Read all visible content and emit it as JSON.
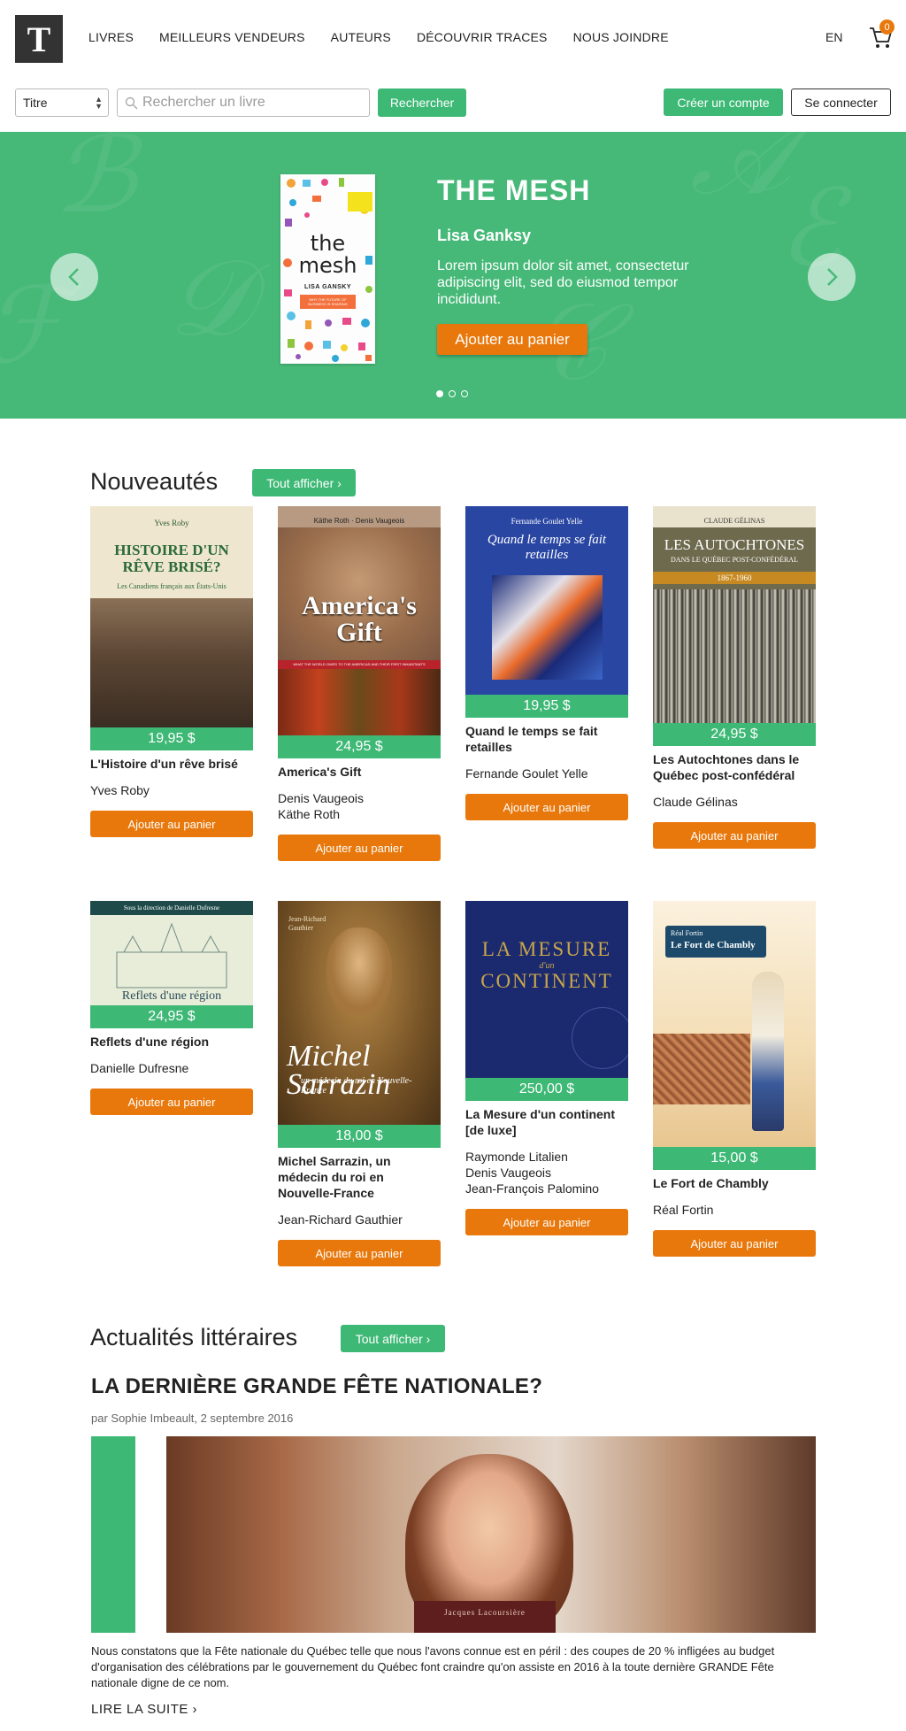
{
  "header": {
    "logo_letter": "T",
    "nav": [
      "LIVRES",
      "MEILLEURS VENDEURS",
      "AUTEURS",
      "DÉCOUVRIR TRACES",
      "NOUS JOINDRE"
    ],
    "lang": "EN",
    "cart_count": "0"
  },
  "search": {
    "select_value": "Titre",
    "placeholder": "Rechercher un livre",
    "button": "Rechercher",
    "create_account": "Créer un compte",
    "login": "Se connecter"
  },
  "hero": {
    "title": "THE MESH",
    "author": "Lisa Ganksy",
    "text": "Lorem ipsum dolor sit amet, consectetur adipiscing elit, sed do eiusmod tempor incididunt.",
    "button": "Ajouter au panier",
    "cover": {
      "title_line1": "the",
      "title_line2": "mesh",
      "author": "LISA GANSKY",
      "subtitle": "WHY THE FUTURE OF BUSINESS IS SHARING"
    },
    "slides": 3,
    "active_slide": 1
  },
  "nouveautes": {
    "title": "Nouveautés",
    "show_all": "Tout afficher ›",
    "books": [
      {
        "cover_top": "Yves Roby",
        "cover_title": "HISTOIRE D'UN RÊVE BRISÉ?",
        "cover_sub": "Les Canadiens français aux États-Unis",
        "price": "19,95 $",
        "title": "L'Histoire d'un rêve brisé",
        "authors": [
          "Yves Roby"
        ],
        "button": "Ajouter au panier"
      },
      {
        "cover_top": "Käthe Roth · Denis Vaugeois",
        "cover_title": "America's Gift",
        "cover_sub": "WHAT THE WORLD OWES TO THE AMERICAS AND THEIR FIRST INHABITANTS",
        "price": "24,95 $",
        "title": "America's Gift",
        "authors": [
          "Denis Vaugeois",
          "Käthe Roth"
        ],
        "button": "Ajouter au panier"
      },
      {
        "cover_top": "Fernande Goulet Yelle",
        "cover_title": "Quand le temps se fait retailles",
        "price": "19,95 $",
        "title": "Quand le temps se fait retailles",
        "authors": [
          "Fernande Goulet Yelle"
        ],
        "button": "Ajouter au panier"
      },
      {
        "cover_top": "CLAUDE GÉLINAS",
        "cover_title": "LES AUTOCHTONES",
        "cover_sub": "DANS LE QUÉBEC POST-CONFÉDÉRAL",
        "cover_years": "1867-1960",
        "price": "24,95 $",
        "title": "Les Autochtones dans le Québec post-confédéral",
        "authors": [
          "Claude Gélinas"
        ],
        "button": "Ajouter au panier"
      },
      {
        "cover_top": "Sous la direction de Danielle Dufresne",
        "cover_title": "Reflets d'une région",
        "price": "24,95 $",
        "title": "Reflets d'une région",
        "authors": [
          "Danielle Dufresne"
        ],
        "button": "Ajouter au panier"
      },
      {
        "cover_top": "Jean-Richard Gauthier",
        "cover_title": "Michel Sarrazin",
        "cover_sub": "un médecin du roi en Nouvelle-France",
        "price": "18,00 $",
        "title": "Michel Sarrazin, un médecin du roi en Nouvelle-France",
        "authors": [
          "Jean-Richard Gauthier"
        ],
        "button": "Ajouter au panier"
      },
      {
        "cover_title": "LA MESURE",
        "cover_sub": "d'un",
        "cover_title2": "CONTINENT",
        "price": "250,00 $",
        "title": "La Mesure d'un continent [de luxe]",
        "authors": [
          "Raymonde Litalien",
          "Denis Vaugeois",
          "Jean-François Palomino"
        ],
        "button": "Ajouter au panier"
      },
      {
        "cover_top": "Réal Fortin",
        "cover_title": "Le Fort de Chambly",
        "price": "15,00 $",
        "title": "Le Fort de Chambly",
        "authors": [
          "Réal Fortin"
        ],
        "button": "Ajouter au panier"
      }
    ]
  },
  "actualites": {
    "title": "Actualités littéraires",
    "show_all": "Tout afficher ›",
    "article_title": "LA DERNIÈRE GRANDE FÊTE NATIONALE?",
    "meta": "par Sophie Imbeault, 2 septembre 2016",
    "image_caption": "Jacques Lacoursière",
    "text": "Nous constatons que la Fête nationale du Québec telle que nous l'avons connue est en péril : des coupes de 20 % infligées au budget d'organisation des célébrations par le gouvernement du Québec font craindre qu'on assiste en 2016 à la toute dernière GRANDE Fête nationale digne de ce nom.",
    "read_more": "LIRE LA SUITE ›"
  },
  "colors": {
    "green": "#3db875",
    "hero_green": "#46b978",
    "orange": "#e8780c",
    "dark": "#333333"
  }
}
